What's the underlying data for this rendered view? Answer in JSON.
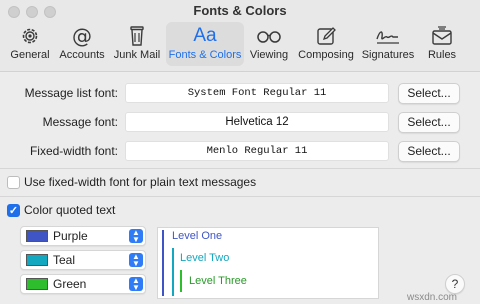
{
  "window": {
    "title": "Fonts & Colors"
  },
  "toolbar": {
    "items": [
      {
        "label": "General",
        "icon": "gear-icon"
      },
      {
        "label": "Accounts",
        "icon": "at-icon"
      },
      {
        "label": "Junk Mail",
        "icon": "trash-icon"
      },
      {
        "label": "Fonts & Colors",
        "icon": "Aa",
        "active": true
      },
      {
        "label": "Viewing",
        "icon": "glasses-icon"
      },
      {
        "label": "Composing",
        "icon": "compose-icon"
      },
      {
        "label": "Signatures",
        "icon": "signature-icon"
      },
      {
        "label": "Rules",
        "icon": "rules-icon"
      }
    ]
  },
  "fonts": {
    "message_list": {
      "label": "Message list font:",
      "value": "System Font Regular 11",
      "button": "Select..."
    },
    "message": {
      "label": "Message font:",
      "value": "Helvetica 12",
      "button": "Select..."
    },
    "fixed_width": {
      "label": "Fixed-width font:",
      "value": "Menlo Regular 11",
      "button": "Select..."
    }
  },
  "options": {
    "fixed_width_plain": {
      "label": "Use fixed-width font for plain text messages",
      "checked": false
    },
    "color_quoted": {
      "label": "Color quoted text",
      "checked": true
    }
  },
  "quote_colors": [
    {
      "name": "Purple",
      "swatch": "#3f55c6"
    },
    {
      "name": "Teal",
      "swatch": "#14a7c0"
    },
    {
      "name": "Green",
      "swatch": "#2dbd2d"
    }
  ],
  "preview": {
    "levels": [
      {
        "text": "Level One",
        "color": "#3f55c6"
      },
      {
        "text": "Level Two",
        "color": "#14a7c0"
      },
      {
        "text": "Level Three",
        "color": "#2a9a2a"
      }
    ]
  },
  "help_label": "?",
  "watermark": "wsxdn.com",
  "colors": {
    "accent": "#1f6feb",
    "window_bg": "#ececec"
  }
}
